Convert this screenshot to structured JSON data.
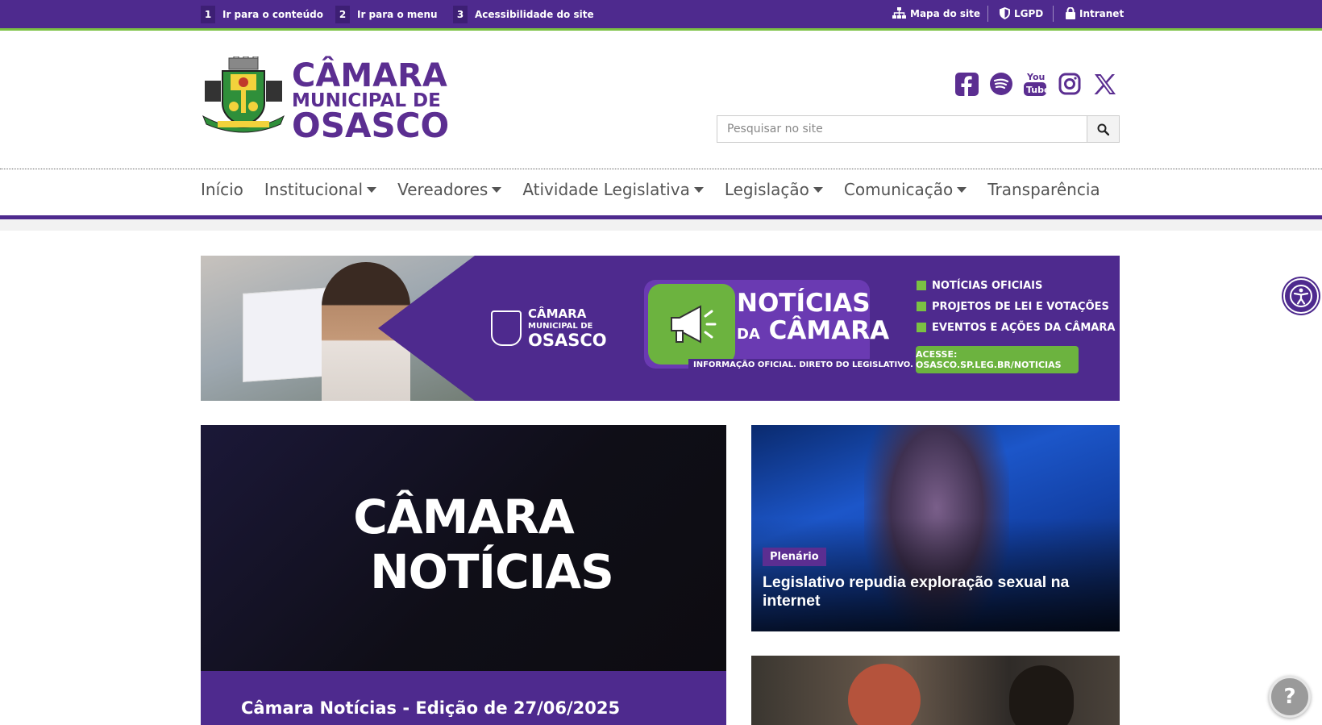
{
  "topbar": {
    "skip_links": [
      {
        "num": "1",
        "label": "Ir para o conteúdo"
      },
      {
        "num": "2",
        "label": "Ir para o menu"
      },
      {
        "num": "3",
        "label": "Acessibilidade do site"
      }
    ],
    "utility_links": [
      {
        "label": "Mapa do site",
        "icon": "sitemap-icon"
      },
      {
        "label": "LGPD",
        "icon": "shield-icon"
      },
      {
        "label": "Intranet",
        "icon": "lock-icon"
      }
    ],
    "colors": {
      "bar": "#4e2a8e",
      "accent_line": "#7bc143"
    }
  },
  "header": {
    "logo": {
      "line1": "CÂMARA",
      "line2": "MUNICIPAL DE",
      "line3": "OSASCO"
    },
    "social": [
      "facebook-icon",
      "spotify-icon",
      "youtube-icon",
      "instagram-icon",
      "x-icon"
    ],
    "search": {
      "placeholder": "Pesquisar no site",
      "icon": "search-icon"
    }
  },
  "nav": {
    "items": [
      {
        "label": "Início",
        "dropdown": false
      },
      {
        "label": "Institucional",
        "dropdown": true
      },
      {
        "label": "Vereadores",
        "dropdown": true
      },
      {
        "label": "Atividade Legislativa",
        "dropdown": true
      },
      {
        "label": "Legislação",
        "dropdown": true
      },
      {
        "label": "Comunicação",
        "dropdown": true
      },
      {
        "label": "Transparência",
        "dropdown": false
      }
    ]
  },
  "banner": {
    "logo_small": "CÂMARA",
    "logo_mid": "MUNICIPAL DE",
    "logo_big": "OSASCO",
    "title_line1": "NOTÍCIAS",
    "title_da": "DA",
    "title_line2": "CÂMARA",
    "subtitle": "INFORMAÇÃO OFICIAL. DIRETO DO LEGISLATIVO.",
    "list": [
      "NOTÍCIAS OFICIAIS",
      "PROJETOS DE LEI E VOTAÇÕES",
      "EVENTOS E AÇÕES DA CÂMARA"
    ],
    "cta": "ACESSE: OSASCO.SP.LEG.BR/NOTICIAS"
  },
  "featured": {
    "image_text_line1": "CÂMARA",
    "image_text_line2": "NOTÍCIAS",
    "caption": "Câmara Notícias - Edição de 27/06/2025"
  },
  "side_news": [
    {
      "tag": "Plenário",
      "title": "Legislativo repudia exploração sexual na internet"
    }
  ],
  "floating": {
    "accessibility": "accessibility-icon",
    "help": "?"
  }
}
